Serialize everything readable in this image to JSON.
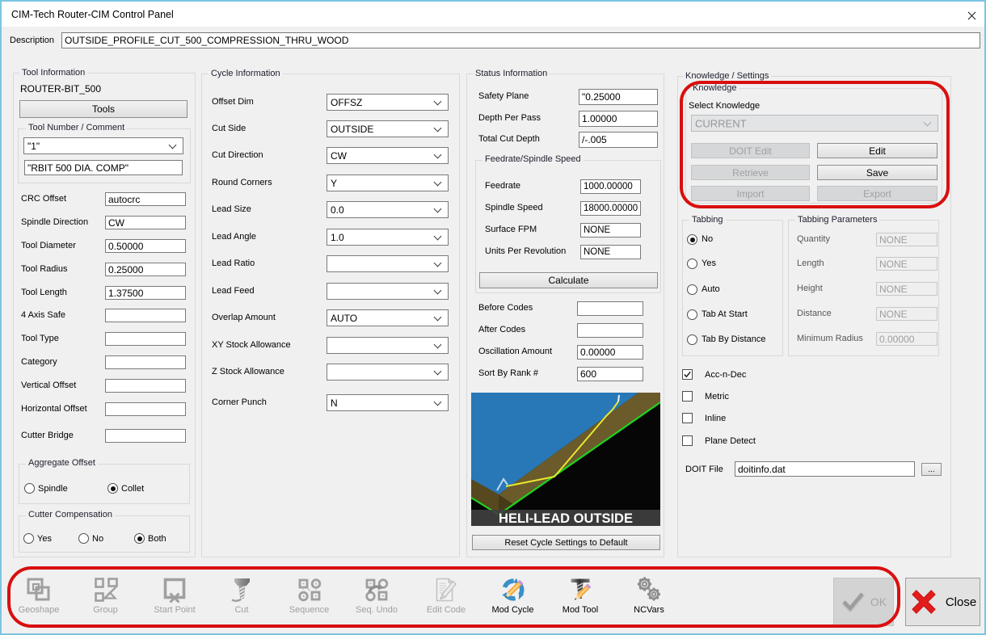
{
  "window": {
    "title": "CIM-Tech Router-CIM Control Panel",
    "close_icon": "close"
  },
  "description": {
    "label": "Description",
    "value": "OUTSIDE_PROFILE_CUT_500_COMPRESSION_THRU_WOOD"
  },
  "tool_information": {
    "title": "Tool Information",
    "tool_name": "ROUTER-BIT_500",
    "tools_button": "Tools",
    "tool_number_group": {
      "title": "Tool Number / Comment",
      "number": "\"1\"",
      "comment": "\"RBIT 500 DIA. COMP\""
    },
    "fields": [
      {
        "label": "CRC Offset",
        "value": "autocrc"
      },
      {
        "label": "Spindle Direction",
        "value": "CW"
      },
      {
        "label": "Tool Diameter",
        "value": "0.50000"
      },
      {
        "label": "Tool Radius",
        "value": "0.25000"
      },
      {
        "label": "Tool Length",
        "value": "1.37500"
      },
      {
        "label": "4 Axis Safe",
        "value": ""
      },
      {
        "label": "Tool Type",
        "value": ""
      },
      {
        "label": "Category",
        "value": ""
      },
      {
        "label": "Vertical Offset",
        "value": ""
      },
      {
        "label": "Horizontal Offset",
        "value": ""
      },
      {
        "label": "Cutter Bridge",
        "value": ""
      }
    ],
    "aggregate_offset": {
      "title": "Aggregate Offset",
      "options": [
        {
          "label": "Spindle",
          "selected": false
        },
        {
          "label": "Collet",
          "selected": true
        }
      ]
    },
    "cutter_compensation": {
      "title": "Cutter Compensation",
      "options": [
        {
          "label": "Yes",
          "selected": false
        },
        {
          "label": "No",
          "selected": false
        },
        {
          "label": "Both",
          "selected": true
        }
      ]
    }
  },
  "cycle_information": {
    "title": "Cycle Information",
    "fields": [
      {
        "label": "Offset Dim",
        "value": "OFFSZ"
      },
      {
        "label": "Cut Side",
        "value": "OUTSIDE"
      },
      {
        "label": "Cut Direction",
        "value": "CW"
      },
      {
        "label": "Round Corners",
        "value": "Y"
      },
      {
        "label": "Lead Size",
        "value": "0.0"
      },
      {
        "label": "Lead Angle",
        "value": "1.0"
      },
      {
        "label": "Lead Ratio",
        "value": ""
      },
      {
        "label": "Lead Feed",
        "value": ""
      },
      {
        "label": "Overlap Amount",
        "value": "AUTO"
      },
      {
        "label": "XY Stock Allowance",
        "value": ""
      },
      {
        "label": "Z Stock Allowance",
        "value": ""
      },
      {
        "label": "Corner Punch",
        "value": "N"
      }
    ]
  },
  "status_information": {
    "title": "Status Information",
    "fields_top": [
      {
        "label": "Safety Plane",
        "value": "\"0.25000"
      },
      {
        "label": "Depth Per Pass",
        "value": "1.00000"
      },
      {
        "label": "Total Cut Depth",
        "value": "/-.005"
      }
    ],
    "feedrate_group": {
      "title": "Feedrate/Spindle Speed",
      "fields": [
        {
          "label": "Feedrate",
          "value": "1000.00000"
        },
        {
          "label": "Spindle Speed",
          "value": "18000.00000"
        },
        {
          "label": "Surface FPM",
          "value": "NONE"
        },
        {
          "label": "Units Per Revolution",
          "value": "NONE"
        }
      ],
      "calculate_button": "Calculate"
    },
    "fields_bottom": [
      {
        "label": "Before Codes",
        "value": ""
      },
      {
        "label": "After Codes",
        "value": ""
      },
      {
        "label": "Oscillation Amount",
        "value": "0.00000"
      },
      {
        "label": "Sort By Rank #",
        "value": "600"
      }
    ],
    "preview_caption": "HELI-LEAD OUTSIDE",
    "reset_button": "Reset Cycle Settings to Default"
  },
  "knowledge_settings": {
    "title": "Knowledge / Settings",
    "knowledge": {
      "title": "Knowledge",
      "select_label": "Select Knowledge",
      "selected_knowledge": "CURRENT",
      "buttons": [
        {
          "label": "DOIT Edit",
          "enabled": false
        },
        {
          "label": "Edit",
          "enabled": true
        },
        {
          "label": "Retrieve",
          "enabled": false
        },
        {
          "label": "Save",
          "enabled": true
        },
        {
          "label": "Import",
          "enabled": false
        },
        {
          "label": "Export",
          "enabled": false
        }
      ]
    },
    "tabbing": {
      "title": "Tabbing",
      "options": [
        {
          "label": "No",
          "selected": true
        },
        {
          "label": "Yes",
          "selected": false
        },
        {
          "label": "Auto",
          "selected": false
        },
        {
          "label": "Tab At Start",
          "selected": false
        },
        {
          "label": "Tab By Distance",
          "selected": false
        }
      ]
    },
    "tabbing_parameters": {
      "title": "Tabbing Parameters",
      "fields": [
        {
          "label": "Quantity",
          "value": "NONE"
        },
        {
          "label": "Length",
          "value": "NONE"
        },
        {
          "label": "Height",
          "value": "NONE"
        },
        {
          "label": "Distance",
          "value": "NONE"
        },
        {
          "label": "Minimum Radius",
          "value": "0.00000"
        }
      ]
    },
    "checkboxes": [
      {
        "label": "Acc-n-Dec",
        "checked": true
      },
      {
        "label": "Metric",
        "checked": false
      },
      {
        "label": "Inline",
        "checked": false
      },
      {
        "label": "Plane Detect",
        "checked": false
      }
    ],
    "doit_file": {
      "label": "DOIT File",
      "value": "doitinfo.dat",
      "browse_button": "..."
    }
  },
  "toolbar": {
    "items": [
      {
        "label": "Geoshape",
        "icon": "geoshape-icon",
        "enabled": false
      },
      {
        "label": "Group",
        "icon": "group-icon",
        "enabled": false
      },
      {
        "label": "Start Point",
        "icon": "start-point-icon",
        "enabled": false
      },
      {
        "label": "Cut",
        "icon": "cut-icon",
        "enabled": false
      },
      {
        "label": "Sequence",
        "icon": "sequence-icon",
        "enabled": false
      },
      {
        "label": "Seq. Undo",
        "icon": "seq-undo-icon",
        "enabled": false
      },
      {
        "label": "Edit Code",
        "icon": "edit-code-icon",
        "enabled": false
      },
      {
        "label": "Mod Cycle",
        "icon": "mod-cycle-icon",
        "enabled": true
      },
      {
        "label": "Mod Tool",
        "icon": "mod-tool-icon",
        "enabled": true
      },
      {
        "label": "NCVars",
        "icon": "ncvars-icon",
        "enabled": true
      }
    ],
    "ok_button": "OK",
    "close_button": "Close"
  },
  "colors": {
    "annotation": "#d90f0f",
    "window_border": "#7cc5e2",
    "preview_surface_blue": "#2878b8",
    "preview_wood_brown": "#6b5a2a",
    "preview_outline_green": "#1ed41e",
    "preview_lead_yellow": "#e8e832"
  }
}
